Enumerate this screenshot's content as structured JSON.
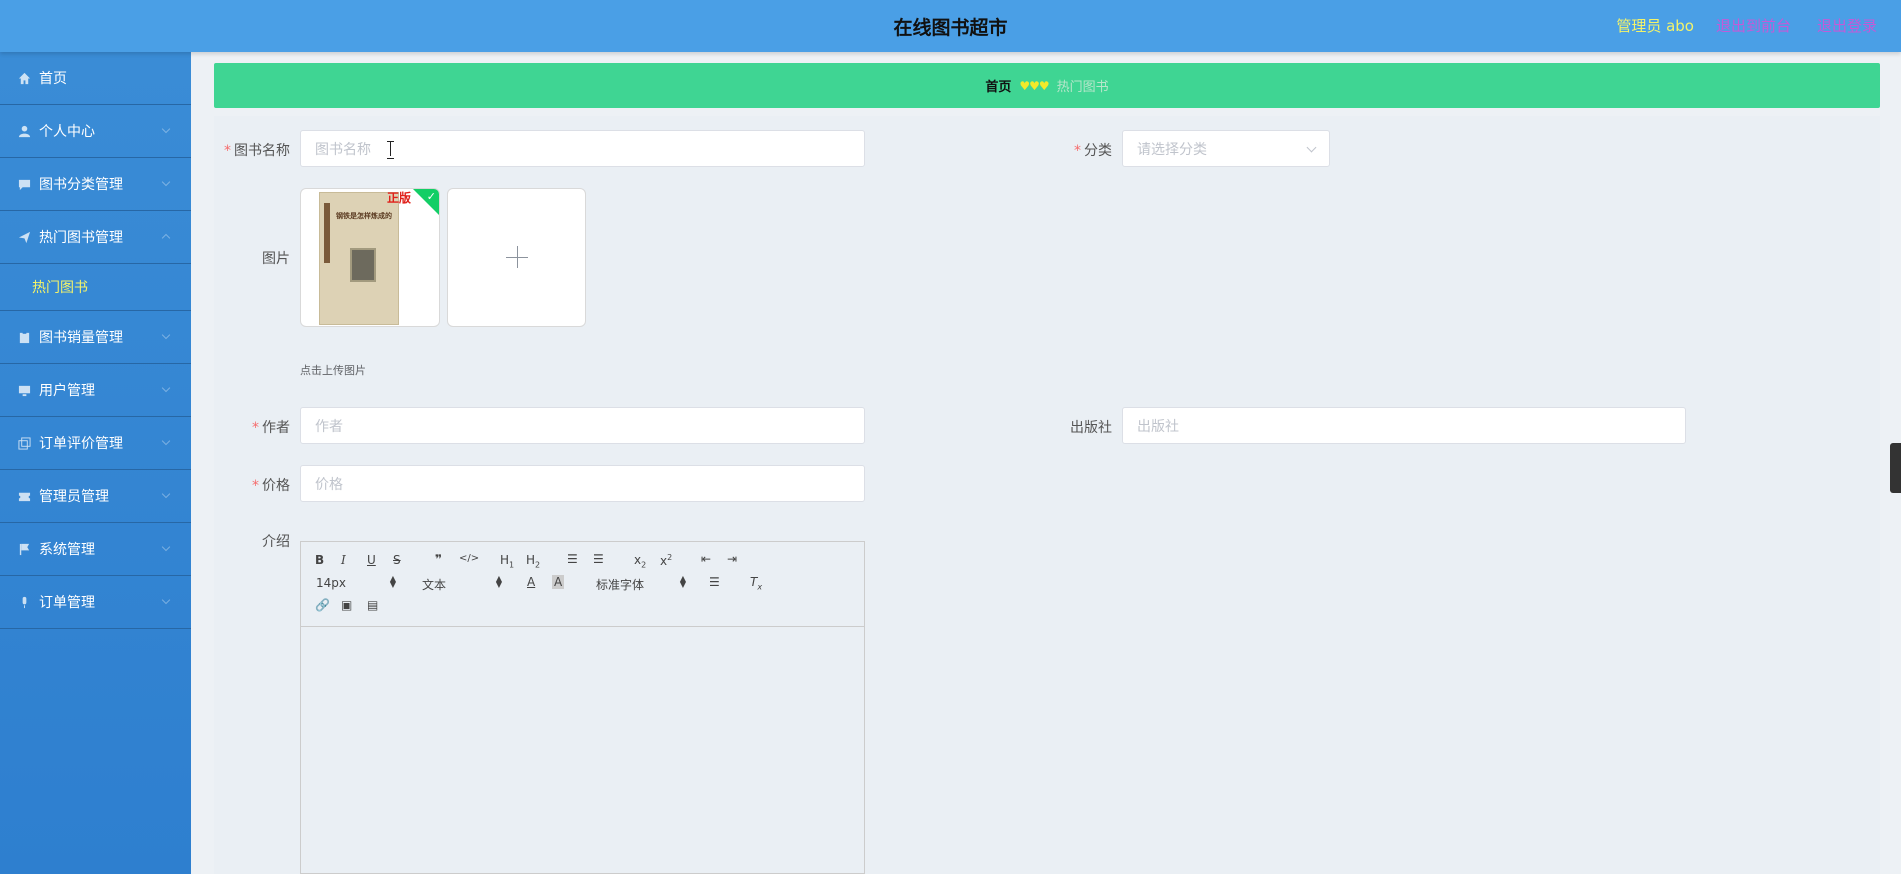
{
  "header": {
    "title": "在线图书超市",
    "admin_label": "管理员 abo",
    "back_front_label": "退出到前台",
    "logout_label": "退出登录"
  },
  "sidebar": {
    "items": [
      {
        "label": "首页",
        "icon": "home-icon"
      },
      {
        "label": "个人中心",
        "icon": "user-icon"
      },
      {
        "label": "图书分类管理",
        "icon": "chat-icon"
      },
      {
        "label": "热门图书管理",
        "icon": "send-icon",
        "expanded": true
      },
      {
        "label": "图书销量管理",
        "icon": "clipboard-icon"
      },
      {
        "label": "用户管理",
        "icon": "monitor-icon"
      },
      {
        "label": "订单评价管理",
        "icon": "copy-icon"
      },
      {
        "label": "管理员管理",
        "icon": "ticket-icon"
      },
      {
        "label": "系统管理",
        "icon": "flag-icon"
      },
      {
        "label": "订单管理",
        "icon": "mic-icon"
      }
    ],
    "sub_item": "热门图书"
  },
  "breadcrumb": {
    "home": "首页",
    "hearts": "♥♥♥",
    "current": "热门图书"
  },
  "form": {
    "name_label": "图书名称",
    "name_placeholder": "图书名称",
    "category_label": "分类",
    "category_placeholder": "请选择分类",
    "image_label": "图片",
    "image_badge": "正版",
    "image_book_title": "钢铁是怎样炼成的",
    "upload_tip": "点击上传图片",
    "author_label": "作者",
    "author_placeholder": "作者",
    "publisher_label": "出版社",
    "publisher_placeholder": "出版社",
    "price_label": "价格",
    "price_placeholder": "价格",
    "intro_label": "介绍"
  },
  "editor": {
    "font_size": "14px",
    "paragraph": "文本",
    "font_family": "标准字体"
  },
  "colors": {
    "header_bg": "#4a9fe6",
    "sidebar_bg": "#3a8cd6",
    "breadcrumb_bg": "#3fd593",
    "accent_yellow": "#f3f36a",
    "accent_purple": "#c25bd8"
  }
}
